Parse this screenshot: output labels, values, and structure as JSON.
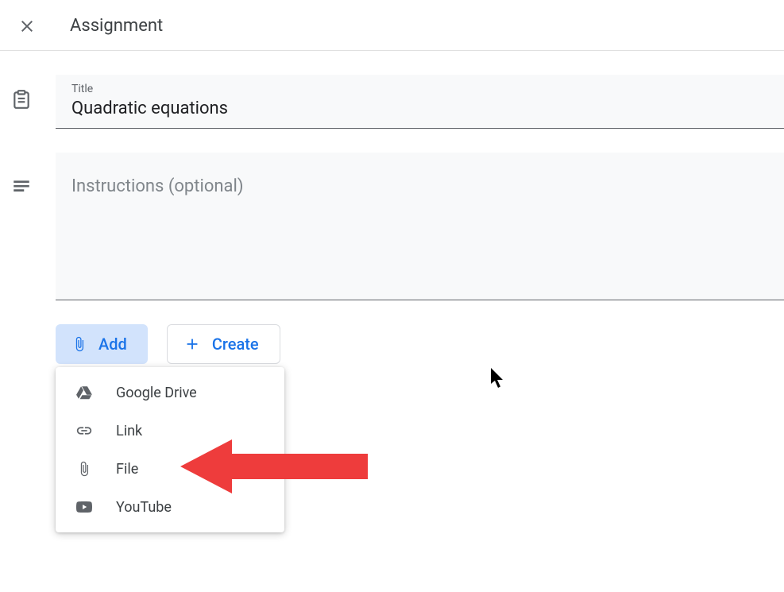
{
  "header": {
    "title": "Assignment"
  },
  "form": {
    "title_label": "Title",
    "title_value": "Quadratic equations",
    "instructions_placeholder": "Instructions (optional)"
  },
  "buttons": {
    "add_label": "Add",
    "create_label": "Create"
  },
  "add_menu": {
    "items": [
      {
        "icon": "drive-icon",
        "label": "Google Drive"
      },
      {
        "icon": "link-icon",
        "label": "Link"
      },
      {
        "icon": "file-icon",
        "label": "File"
      },
      {
        "icon": "youtube-icon",
        "label": "YouTube"
      }
    ]
  }
}
